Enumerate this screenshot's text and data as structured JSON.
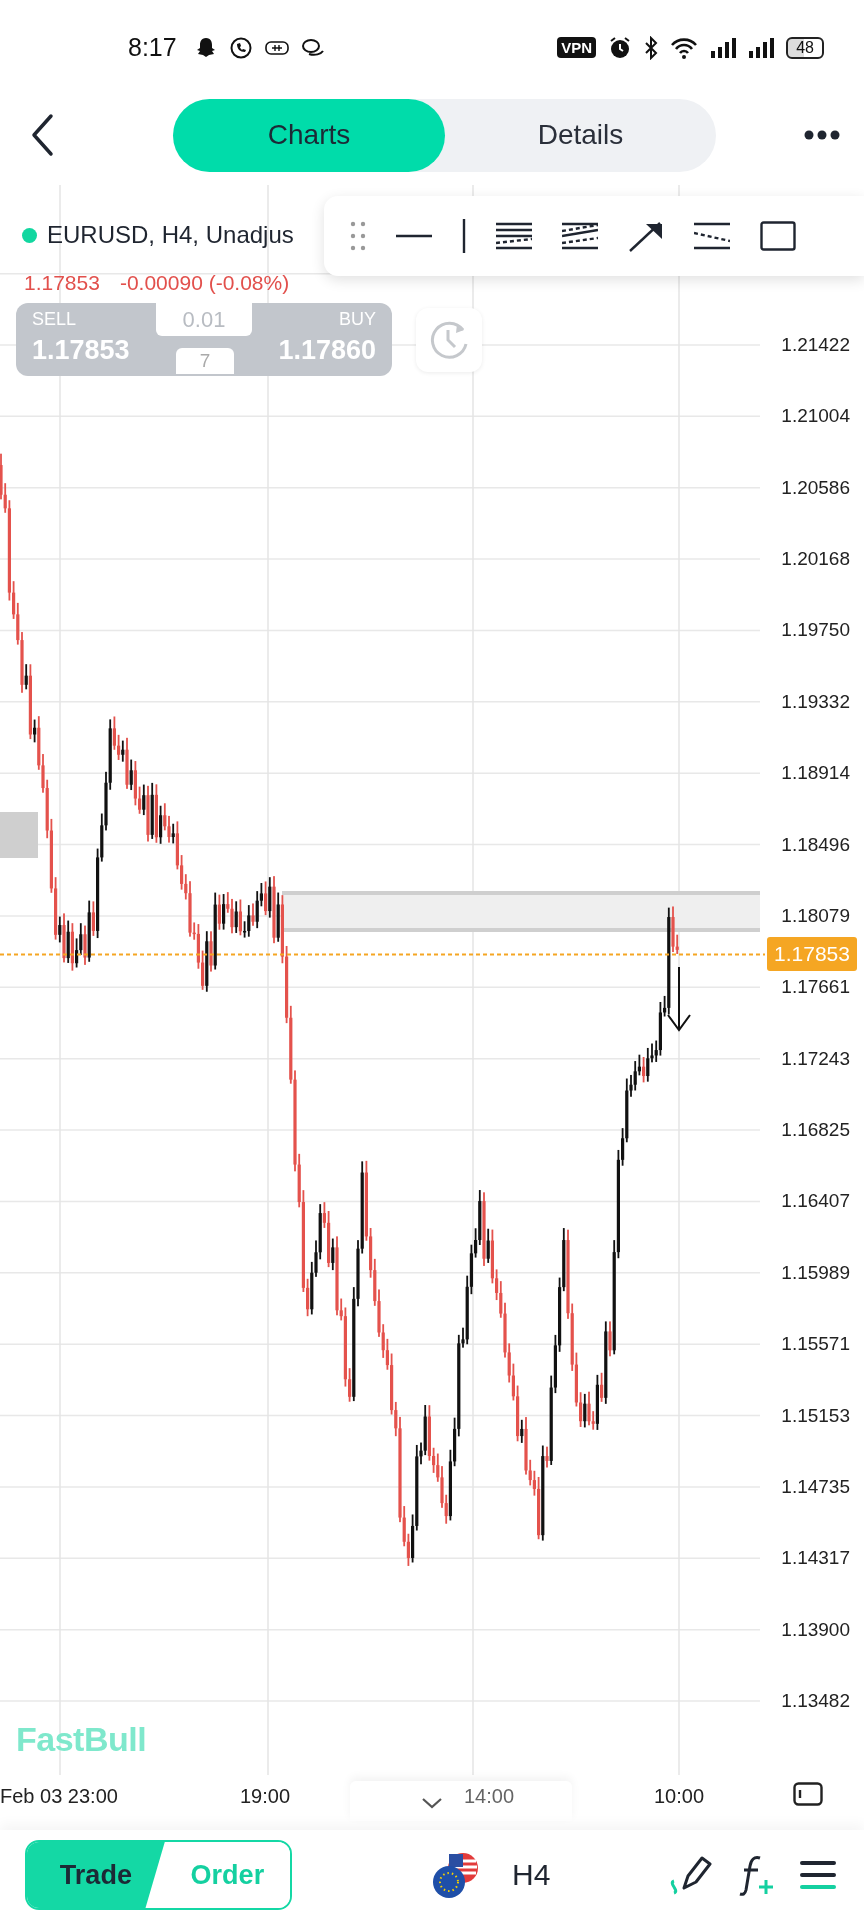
{
  "status_bar": {
    "time": "8:17",
    "vpn_badge": "VPN",
    "battery": "48"
  },
  "header": {
    "tabs": [
      {
        "label": "Charts",
        "selected": true
      },
      {
        "label": "Details",
        "selected": false
      }
    ]
  },
  "symbol": {
    "title": "EURUSD, H4, Unadjus",
    "price": "1.17853",
    "change": "-0.00090 (-0.08%)"
  },
  "trade_panel": {
    "sell_label": "SELL",
    "sell_price": "1.17853",
    "buy_label": "BUY",
    "buy_price": "1.17860",
    "lot": "0.01",
    "spread": "7"
  },
  "chart": {
    "price_labels": [
      "1.21422",
      "1.21004",
      "1.20586",
      "1.20168",
      "1.19750",
      "1.19332",
      "1.18914",
      "1.18496",
      "1.18079",
      "1.17661",
      "1.17243",
      "1.16825",
      "1.16407",
      "1.15989",
      "1.15571",
      "1.15153",
      "1.14735",
      "1.14317",
      "1.13900",
      "1.13482"
    ],
    "current_price": "1.17853",
    "logo": "FastBull",
    "time_labels": [
      "Feb 03 23:00",
      "19:00",
      "14:00",
      "10:00"
    ]
  },
  "bottom_bar": {
    "modes": [
      {
        "label": "Trade",
        "selected": true
      },
      {
        "label": "Order",
        "selected": false
      }
    ],
    "timeframe": "H4"
  }
}
